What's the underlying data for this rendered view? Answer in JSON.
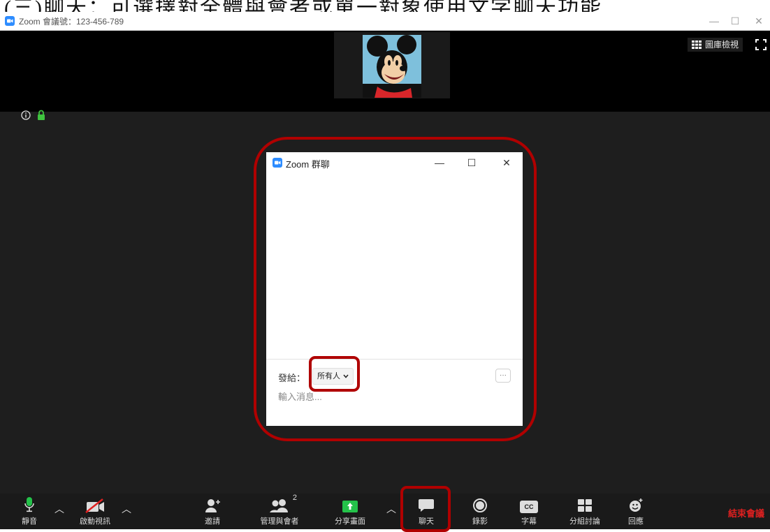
{
  "caption_text": "(三)聊天：可選擇對全體與會者或單一對象使用文字聊天功能",
  "window": {
    "title": "Zoom 會議號：123-456-789",
    "controls": {
      "minimize": "—",
      "maximize": "☐",
      "close": "✕"
    }
  },
  "top_bar": {
    "gallery_view_label": "圖庫檢視"
  },
  "chat_window": {
    "title": "Zoom 群聊",
    "controls": {
      "minimize": "—",
      "maximize": "☐",
      "close": "✕"
    },
    "send_to_label": "發給：",
    "recipient_value": "所有人",
    "more_label": "···",
    "input_placeholder": "輸入消息..."
  },
  "toolbar": {
    "mute_label": "靜音",
    "video_label": "啟動視訊",
    "invite_label": "邀請",
    "participants_label": "管理與會者",
    "participants_count": "2",
    "share_label": "分享畫面",
    "chat_label": "聊天",
    "record_label": "錄影",
    "captions_label": "字幕",
    "captions_icon_text": "CC",
    "breakout_label": "分組討論",
    "reactions_label": "回應",
    "end_label": "結束會議"
  },
  "colors": {
    "zoom_blue": "#2d8cff",
    "annotation_red": "#b00000",
    "end_red": "#e02020",
    "share_green": "#24c24a",
    "lock_green": "#3fc43f"
  },
  "icons": [
    "zoom-logo-icon",
    "info-icon",
    "lock-icon",
    "gallery-grid-icon",
    "fullscreen-icon",
    "microphone-icon",
    "video-off-icon",
    "invite-icon",
    "participants-icon",
    "share-screen-icon",
    "chat-icon",
    "record-icon",
    "captions-icon",
    "breakout-icon",
    "reactions-icon",
    "caret-up-icon"
  ]
}
